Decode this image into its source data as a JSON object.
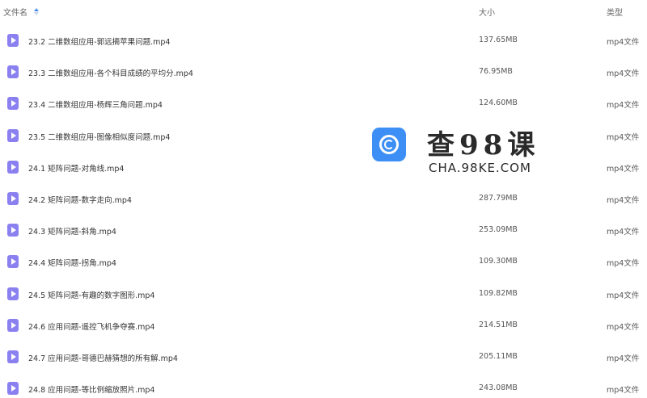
{
  "header": {
    "name_label": "文件名",
    "size_label": "大小",
    "type_label": "类型"
  },
  "files": [
    {
      "name": "23.2 二维数组应用-郭远摘苹果问题.mp4",
      "size": "137.65MB",
      "type": "mp4文件"
    },
    {
      "name": "23.3 二维数组应用-各个科目成绩的平均分.mp4",
      "size": "76.95MB",
      "type": "mp4文件"
    },
    {
      "name": "23.4 二维数组应用-杨辉三角问题.mp4",
      "size": "124.60MB",
      "type": "mp4文件"
    },
    {
      "name": "23.5 二维数组应用-图像相似度问题.mp4",
      "size": "",
      "type": "mp4文件"
    },
    {
      "name": "24.1 矩阵问题-对角线.mp4",
      "size": "",
      "type": "mp4文件"
    },
    {
      "name": "24.2 矩阵问题-数字走向.mp4",
      "size": "287.79MB",
      "type": "mp4文件"
    },
    {
      "name": "24.3 矩阵问题-斜角.mp4",
      "size": "253.09MB",
      "type": "mp4文件"
    },
    {
      "name": "24.4 矩阵问题-拐角.mp4",
      "size": "109.30MB",
      "type": "mp4文件"
    },
    {
      "name": "24.5 矩阵问题-有趣的数字图形.mp4",
      "size": "109.82MB",
      "type": "mp4文件"
    },
    {
      "name": "24.6 应用问题-遥控飞机争夺赛.mp4",
      "size": "214.51MB",
      "type": "mp4文件"
    },
    {
      "name": "24.7 应用问题-哥德巴赫猜想的所有解.mp4",
      "size": "205.11MB",
      "type": "mp4文件"
    },
    {
      "name": "24.8 应用问题-等比例缩放照片.mp4",
      "size": "243.08MB",
      "type": "mp4文件"
    }
  ],
  "watermark": {
    "title": "查98课",
    "url": "CHA.98KE.COM"
  },
  "colors": {
    "file_icon": "#8b80f0",
    "sort_accent": "#4a8cf0",
    "logo": "#3d8ff5"
  },
  "icons": {
    "file": "video-file-icon",
    "sort": "sort-icon",
    "logo": "logo-icon"
  }
}
